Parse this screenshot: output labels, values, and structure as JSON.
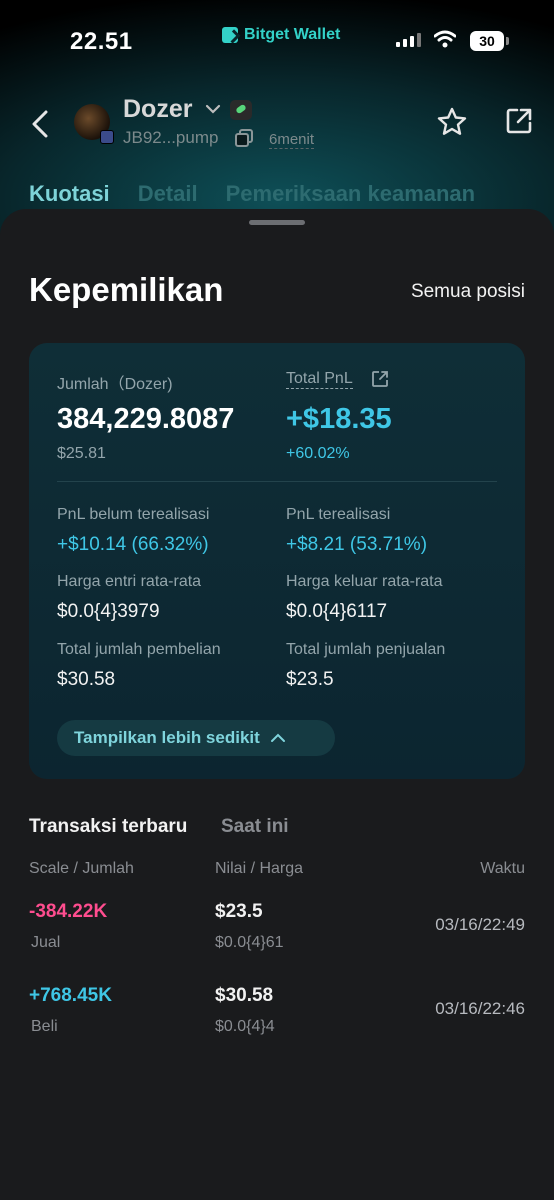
{
  "status": {
    "time": "22.51",
    "brand": "Bitget Wallet",
    "battery": "30"
  },
  "header": {
    "token_name": "Dozer",
    "address": "JB92...pump",
    "age": "6menit"
  },
  "tabs": [
    {
      "label": "Kuotasi"
    },
    {
      "label": "Detail"
    },
    {
      "label": "Pemeriksaan keamanan"
    }
  ],
  "holdings": {
    "title": "Kepemilikan",
    "all_positions": "Semua posisi",
    "amount_label": "Jumlah（Dozer)",
    "amount": "384,229.8087",
    "amount_usd": "$25.81",
    "pnl_label": "Total PnL",
    "pnl": "+$18.35",
    "pnl_pct": "+60.02%",
    "unrealized_label": "PnL belum terealisasi",
    "unrealized": "+$10.14 (66.32%)",
    "realized_label": "PnL terealisasi",
    "realized": "+$8.21 (53.71%)",
    "avg_entry_label": "Harga entri rata-rata",
    "avg_entry": "$0.0{4}3979",
    "avg_exit_label": "Harga keluar rata-rata",
    "avg_exit": "$0.0{4}6117",
    "total_buy_label": "Total jumlah pembelian",
    "total_buy": "$30.58",
    "total_sell_label": "Total jumlah penjualan",
    "total_sell": "$23.5",
    "show_less": "Tampilkan lebih sedikit"
  },
  "transactions": {
    "title": "Transaksi terbaru",
    "filter": "Saat ini",
    "columns": [
      "Scale / Jumlah",
      "Nilai / Harga",
      "Waktu"
    ],
    "rows": [
      {
        "amount": "-384.22K",
        "type": "Jual",
        "value": "$23.5",
        "price": "$0.0{4}61",
        "time": "03/16/22:49"
      },
      {
        "amount": "+768.45K",
        "type": "Beli",
        "value": "$30.58",
        "price": "$0.0{4}4",
        "time": "03/16/22:46"
      }
    ]
  },
  "colors": {
    "accent": "#3fc7e6",
    "negative": "#ff4d8f",
    "brand": "#33d2c8"
  }
}
